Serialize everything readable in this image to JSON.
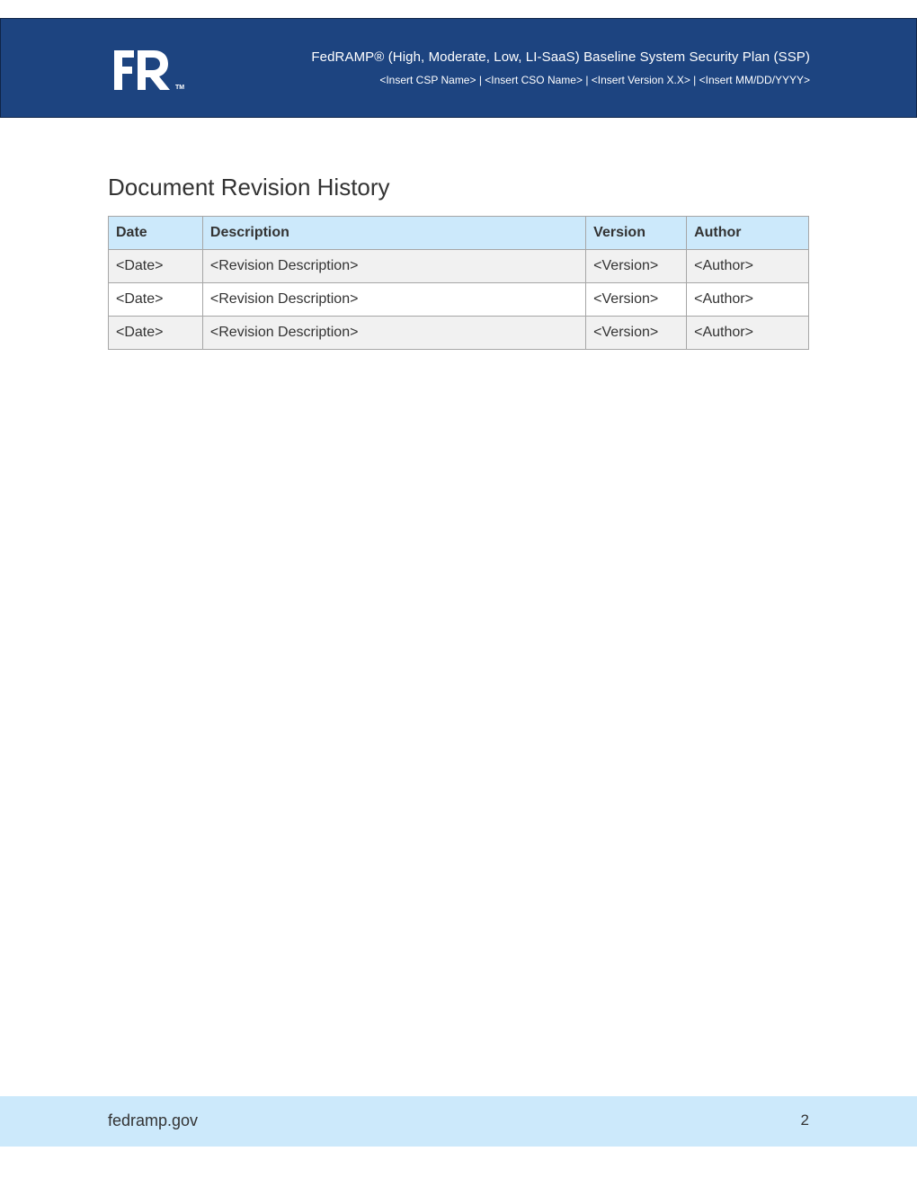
{
  "header": {
    "logo_text": "FR",
    "logo_tm": "TM",
    "title": "FedRAMP® (High, Moderate, Low, LI-SaaS) Baseline System Security Plan (SSP)",
    "subtitle": "<Insert CSP Name> | <Insert CSO Name> | <Insert Version X.X> | <Insert MM/DD/YYYY>",
    "band_color": "#1d4480"
  },
  "section": {
    "title": "Document Revision History"
  },
  "table": {
    "headers": [
      "Date",
      "Description",
      "Version",
      "Author"
    ],
    "rows": [
      [
        "<Date>",
        "<Revision Description>",
        "<Version>",
        "<Author>"
      ],
      [
        "<Date>",
        "<Revision Description>",
        "<Version>",
        "<Author>"
      ],
      [
        "<Date>",
        "<Revision Description>",
        "<Version>",
        "<Author>"
      ]
    ],
    "header_color": "#cce9fb",
    "shaded_row_color": "#f1f1f1"
  },
  "footer": {
    "site": "fedramp.gov",
    "page_number": "2",
    "band_color": "#cce9fb"
  }
}
